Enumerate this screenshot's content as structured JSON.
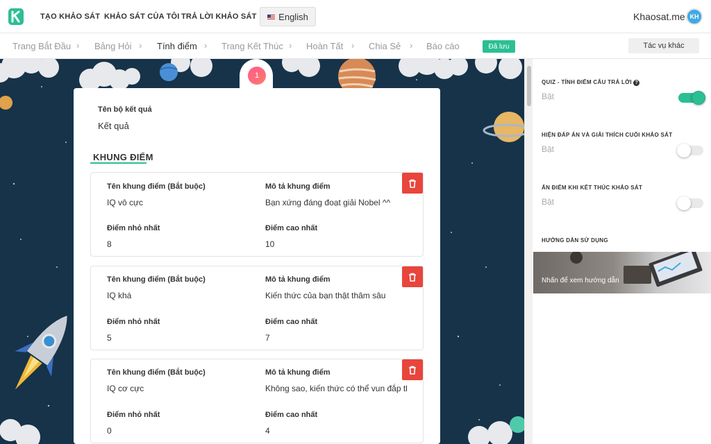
{
  "topnav": {
    "items": [
      "TẠO KHẢO SÁT",
      "KHẢO SÁT CỦA TÔI",
      "TRẢ LỜI KHẢO SÁT"
    ],
    "language": "English",
    "brand": "Khaosat.me",
    "avatar_initials": "KH"
  },
  "breadcrumb": {
    "steps": [
      "Trang Bắt Đầu",
      "Bảng Hỏi",
      "Tính điểm",
      "Trang Kết Thúc",
      "Hoàn Tất",
      "Chia Sẻ",
      "Báo cáo"
    ],
    "active_step": "Tính điểm",
    "saved_badge": "Đã lưu",
    "more_actions": "Tác vụ khác"
  },
  "result_set": {
    "index": "1",
    "name_label": "Tên bộ kết quả",
    "name_value": "Kết quả"
  },
  "score_ranges": {
    "heading": "KHUNG ĐIỂM",
    "name_label": "Tên khung điểm (Bắt buộc)",
    "desc_label": "Mô tả khung điểm",
    "min_label": "Điểm nhỏ nhất",
    "max_label": "Điểm cao nhất",
    "items": [
      {
        "name": "IQ vô cực",
        "description": "Bạn xứng đáng đoạt giải Nobel ^^",
        "min": "8",
        "max": "10"
      },
      {
        "name": "IQ khá",
        "description": "Kiến thức của bạn thật thâm sâu",
        "min": "5",
        "max": "7"
      },
      {
        "name": "IQ cơ cực",
        "description": "Không sao, kiến thức có thể vun đắp thêm",
        "min": "0",
        "max": "4"
      }
    ]
  },
  "settings": {
    "quiz_title": "QUIZ - TÍNH ĐIỂM CÂU TRẢ LỜI",
    "quiz_state": "Bật",
    "quiz_enabled": true,
    "show_answers_title": "HIỆN ĐÁP ÁN VÀ GIẢI THÍCH CUỐI KHẢO SÁT",
    "show_answers_state": "Bật",
    "show_answers_enabled": false,
    "hide_score_title": "ẨN ĐIỂM KHI KẾT THÚC KHẢO SÁT",
    "hide_score_state": "Bật",
    "hide_score_enabled": false,
    "guide_title": "HƯỚNG DẪN SỬ DỤNG",
    "guide_link": "Nhấn để xem hướng dẫn"
  },
  "colors": {
    "accent": "#2bbf93",
    "danger": "#e8453c",
    "space_bg": "#16334a",
    "badge_pink": "#ff5c8a"
  }
}
